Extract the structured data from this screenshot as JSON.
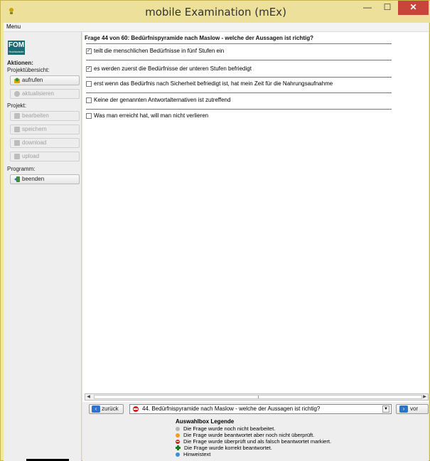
{
  "window": {
    "title": "mobile Examination (mEx)",
    "controls": {
      "minimize": "—",
      "maximize": "☐",
      "close": "✕"
    },
    "accent_color": "#ece09a",
    "close_color": "#c7453b"
  },
  "menubar": {
    "menu_label": "Menu"
  },
  "sidebar": {
    "logo_text": "FOM",
    "logo_sub": "Hochschule",
    "aktionen_label": "Aktionen:",
    "projektuebersicht_label": "Projektübersicht:",
    "aufrufen": "aufrufen",
    "aktualisieren": "aktualisieren",
    "projekt_label": "Projekt:",
    "bearbeiten": "bearbeiten",
    "speichern": "speichern",
    "download": "download",
    "upload": "upload",
    "programm_label": "Programm:",
    "beenden": "beenden"
  },
  "question": {
    "title": "Frage 44 von 60: Bedürfnispyramide nach Maslow - welche der Aussagen ist richtig?",
    "options": [
      {
        "text": "teilt die menschlichen Bedürfnisse in fünf Stufen ein",
        "checked": "✓"
      },
      {
        "text": "es werden zuerst die Bedürfnisse der unteren Stufen befriedigt",
        "checked": "✓"
      },
      {
        "text": "erst wenn das Bedürfnis nach Sicherheit befriedigt ist, hat mein Zeit für die Nahrungsaufnahme",
        "checked": ""
      },
      {
        "text": "Keine der genannten Antwortalternativen ist zutreffend",
        "checked": ""
      },
      {
        "text": "Was man erreicht hat, will man nicht verlieren",
        "checked": ""
      }
    ]
  },
  "navigation": {
    "prev_label": "zurück",
    "next_label": "vor",
    "selected_question": "44. Bedürfnispyramide nach Maslow - welche der Aussagen ist richtig?"
  },
  "legend": {
    "title": "Auswahlbox Legende",
    "items": [
      {
        "text": "Die Frage wurde noch nicht bearbeitet.",
        "color": "#b5b5b5"
      },
      {
        "text": "Die Frage wurde beantwortet aber noch nicht überprüft.",
        "color": "#f0a020"
      },
      {
        "text": "Die Frage wurde überprüft und als falsch beantwortet markiert.",
        "color": "#d42020"
      },
      {
        "text": "Die Frage wurde korrekt beantwortet.",
        "color": "#1e7a1e"
      },
      {
        "text": "Hinweistext",
        "color": "#3a8fd8"
      }
    ]
  }
}
